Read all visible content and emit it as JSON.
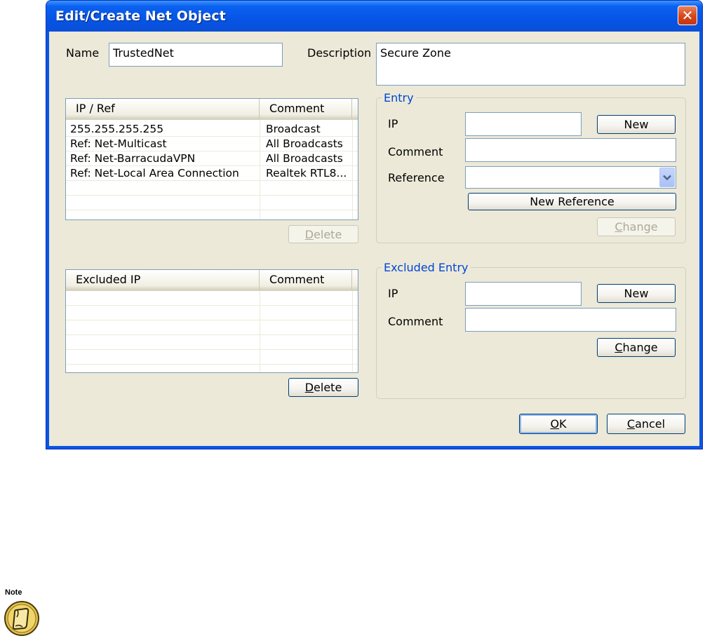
{
  "window": {
    "title": "Edit/Create Net Object",
    "close_glyph": "✕"
  },
  "name_section": {
    "label": "Name",
    "value": "TrustedNet"
  },
  "description_section": {
    "label": "Description",
    "value": "Secure Zone"
  },
  "ip_list": {
    "columns": [
      "IP / Ref",
      "Comment"
    ],
    "rows": [
      {
        "ip": "255.255.255.255",
        "comment": "Broadcast"
      },
      {
        "ip": "Ref: Net-Multicast",
        "comment": "All Broadcasts"
      },
      {
        "ip": "Ref: Net-BarracudaVPN",
        "comment": "All Broadcasts"
      },
      {
        "ip": "Ref: Net-Local Area Connection",
        "comment": "Realtek RTL8..."
      }
    ],
    "delete_label": "Delete",
    "delete_mnemonic": "D",
    "delete_rest": "elete"
  },
  "excluded_list": {
    "columns": [
      "Excluded IP",
      "Comment"
    ],
    "delete_mnemonic": "D",
    "delete_rest": "elete"
  },
  "entry_group": {
    "title": "Entry",
    "ip_label": "IP",
    "ip_value": "",
    "comment_label": "Comment",
    "comment_value": "",
    "reference_label": "Reference",
    "reference_value": "",
    "new_label": "New",
    "new_reference_label": "New Reference",
    "change_mnemonic": "C",
    "change_rest": "hange"
  },
  "excluded_group": {
    "title": "Excluded Entry",
    "ip_label": "IP",
    "ip_value": "",
    "comment_label": "Comment",
    "comment_value": "",
    "new_label": "New",
    "change_mnemonic": "C",
    "change_rest": "hange"
  },
  "footer": {
    "ok_mnemonic": "O",
    "ok_rest": "K",
    "cancel_mnemonic": "C",
    "cancel_rest": "ancel"
  },
  "note": {
    "label": "Note"
  },
  "colors": {
    "titlebar": "#0655e6",
    "dialog_face": "#ece9d8",
    "group_title": "#0046d5",
    "close_button": "#d6461c"
  }
}
